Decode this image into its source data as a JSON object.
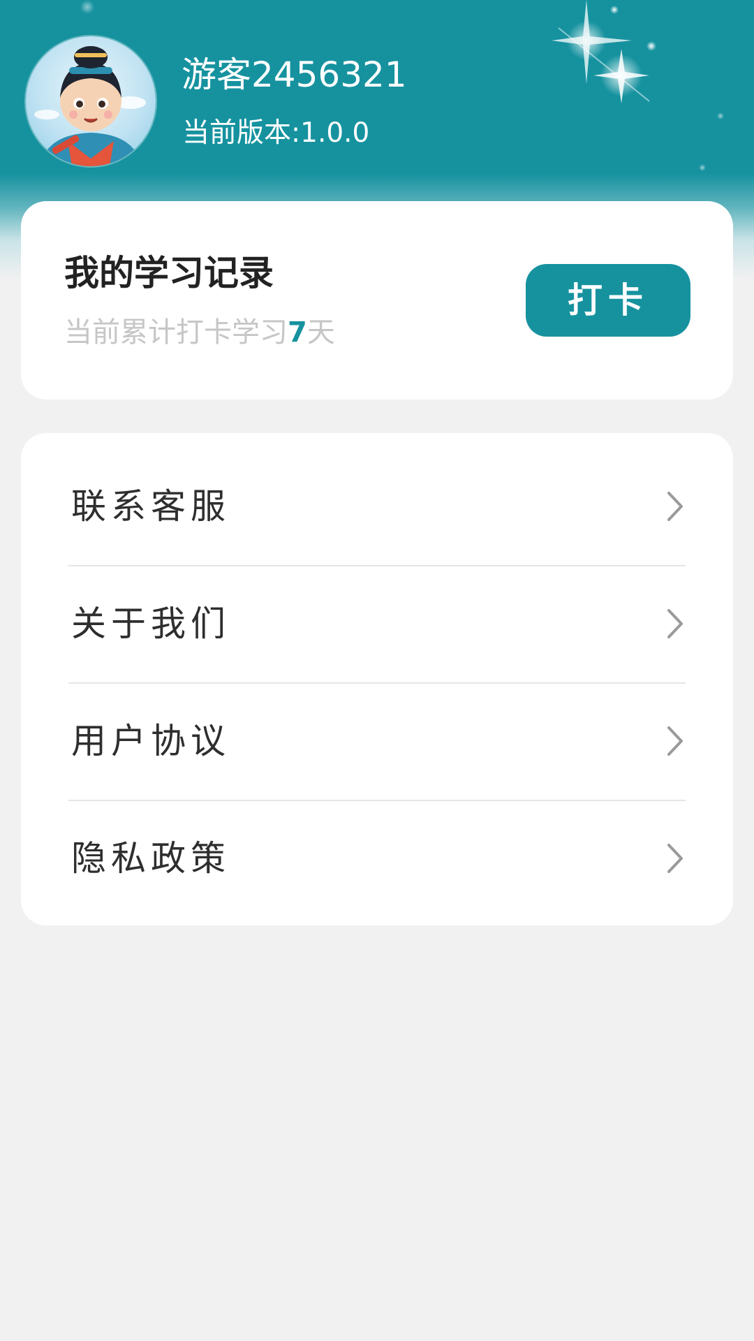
{
  "header": {
    "username": "游客2456321",
    "version_text": "当前版本:1.0.0",
    "accent_color": "#16929f",
    "avatar_icon": "cartoon-scholar-avatar-icon"
  },
  "record": {
    "title": "我的学习记录",
    "sub_prefix": "当前累计打卡学习",
    "days": "7",
    "sub_suffix": "天",
    "checkin_label": "打卡"
  },
  "menu": {
    "items": [
      {
        "label": "联系客服",
        "icon": "chevron-right-icon"
      },
      {
        "label": "关于我们",
        "icon": "chevron-right-icon"
      },
      {
        "label": "用户协议",
        "icon": "chevron-right-icon"
      },
      {
        "label": "隐私政策",
        "icon": "chevron-right-icon"
      }
    ]
  }
}
